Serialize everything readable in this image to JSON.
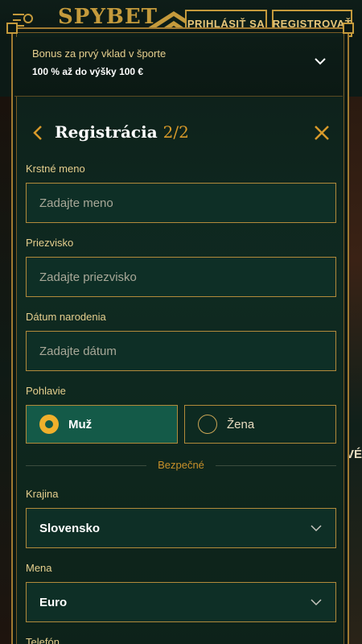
{
  "header": {
    "logo": "SPYBET",
    "login_label": "PRIHLÁSIŤ SA",
    "register_label": "REGISTROVAŤ"
  },
  "side_peek_text": "VÉ",
  "bonus": {
    "line1": "Bonus za prvý vklad v športe",
    "line2": "100 % až do výšky 100 €"
  },
  "form": {
    "title": "Registrácia",
    "step": "2/2",
    "first_name": {
      "label": "Krstné meno",
      "placeholder": "Zadajte meno"
    },
    "last_name": {
      "label": "Priezvisko",
      "placeholder": "Zadajte priezvisko"
    },
    "birth_date": {
      "label": "Dátum narodenia",
      "placeholder": "Zadajte dátum"
    },
    "gender": {
      "label": "Pohlavie",
      "options": [
        {
          "label": "Muž",
          "selected": true
        },
        {
          "label": "Žena",
          "selected": false
        }
      ]
    },
    "divider_text": "Bezpečné",
    "country": {
      "label": "Krajina",
      "value": "Slovensko"
    },
    "currency": {
      "label": "Mena",
      "value": "Euro"
    },
    "phone": {
      "label": "Telefón"
    }
  },
  "colors": {
    "accent_gold": "#c49a3c",
    "step_orange": "#d89a2a",
    "selected_green": "#145a48"
  }
}
